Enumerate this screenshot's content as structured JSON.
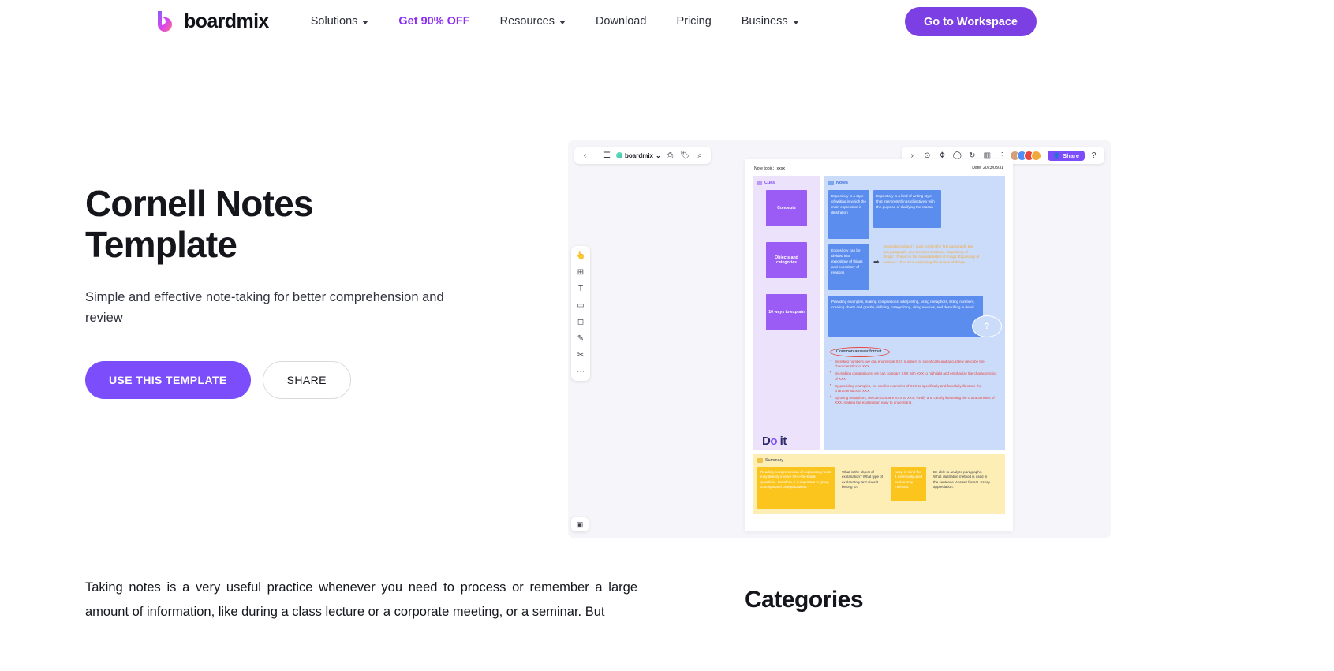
{
  "header": {
    "logo_text": "boardmix",
    "logo_icon": "boardmix-b-logo-icon",
    "nav": [
      {
        "label": "Solutions",
        "has_caret": true,
        "promo": false
      },
      {
        "label": "Get 90% OFF",
        "has_caret": false,
        "promo": true
      },
      {
        "label": "Resources",
        "has_caret": true,
        "promo": false
      },
      {
        "label": "Download",
        "has_caret": false,
        "promo": false
      },
      {
        "label": "Pricing",
        "has_caret": false,
        "promo": false
      },
      {
        "label": "Business",
        "has_caret": true,
        "promo": false
      }
    ],
    "cta_label": "Go to Workspace",
    "cta_color": "#7b3fe4"
  },
  "hero": {
    "title_line1": "Cornell Notes",
    "title_line2": "Template",
    "subtitle": "Simple and effective note-taking for better comprehension and review",
    "primary_button": "USE THIS TEMPLATE",
    "secondary_button": "SHARE",
    "primary_color": "#7b4dfb"
  },
  "preview": {
    "topbar": {
      "back_icon": "chevron-left-icon",
      "menu_icon": "hamburger-menu-icon",
      "brand_label": "boardmix",
      "brand_caret_icon": "chevron-down-icon",
      "save_icon": "save-icon",
      "tag_icon": "tag-icon",
      "search_icon": "search-icon",
      "right_icons": [
        "chevron-right-icon",
        "play-circle-icon",
        "presenter-icon",
        "comment-icon",
        "timer-icon",
        "vote-icon",
        "more-vertical-icon"
      ],
      "share_label": "Share",
      "share_icon": "share-person-icon",
      "help_icon": "help-circle-icon",
      "avatars": [
        "#d4a07a",
        "#4f8ef7",
        "#e8453c",
        "#f2a93b"
      ]
    },
    "rail_icons": [
      "cursor-select-icon",
      "frame-icon",
      "text-icon",
      "sticky-note-icon",
      "shape-icon",
      "pen-icon",
      "connector-icon",
      "more-dots-icon"
    ],
    "minimap_icon": "minimap-icon",
    "board": {
      "note_topic_label": "Note topic：xxxx",
      "date_label": "Date: 2023/03/31",
      "cues_title": "Cues",
      "notes_title": "Notes",
      "summary_title": "Summary",
      "cue_cards": [
        "Concepts",
        "Objects and categories",
        "10 ways to explain"
      ],
      "note_cards": [
        "Expository is a style of writing in which the main expression is illustration",
        "Expository is a kind of writing style that interprets things objectively with the purpose of clarifying the reason",
        "Expository can be divided into expository of things and expository of reasons",
        "Providing examples, making comparisons, interpreting, using metaphors, listing numbers, creating charts and graphs, defining, categorizing, citing sources, and describing in detail"
      ],
      "description_text": "Description object：Look for it in the first paragraph, the last paragraph, and the topic sentence. Expository of things：Focus on the characteristics of things. Expository of reasons：Focus on explaining the reason of things.",
      "thought_glyph": "?",
      "answer_format_label": "Common answer format",
      "bullets": [
        "By listing numbers, we can enumerate XXX numbers to specifically and accurately describe the characteristics of XXX.",
        "By making comparisons, we can compare XXX with XXX to highlight and emphasize the characteristics of XXX.",
        "By providing examples, we can list examples of XXX to specifically and forcefully illustrate the characteristics of XXX.",
        "By using metaphors, we can compare XXX to XXX, vividly and clearly illustrating the characteristics of XXX, making the explanation easy to understand."
      ],
      "doit_text": "Do it",
      "summary_cards": [
        "Reading comprehension of explanatory texts may directly involve fill-in-the-blank questions, therefore, it is important to grasp concepts and categorizations.",
        "What is the object of explanation? What type of explanatory text does it belong to?",
        "Keep in mind the 4 commonly used explanatory methods.",
        "Be able to analyze paragraphs. What illustrative method is used in the sentence. Answer format. Essay appreciation."
      ]
    }
  },
  "bottom": {
    "paragraph": "Taking notes is a very useful practice whenever you need to process or remember a large amount of information, like during a class lecture or a corporate meeting, or a seminar. But",
    "categories_title": "Categories"
  }
}
